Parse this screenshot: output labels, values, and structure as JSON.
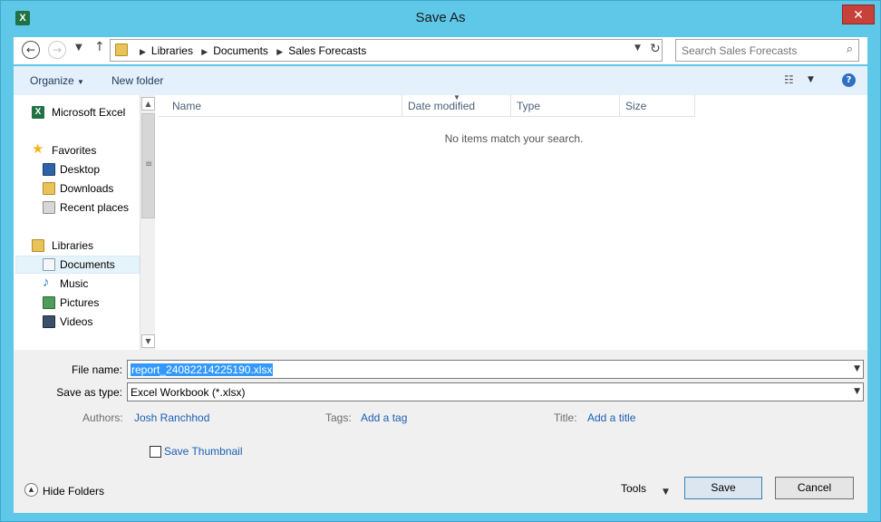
{
  "window": {
    "title": "Save As",
    "app_icon_letter": "X",
    "close_label": "✕"
  },
  "nav": {
    "breadcrumbs": [
      "Libraries",
      "Documents",
      "Sales Forecasts"
    ],
    "search_placeholder": "Search Sales Forecasts"
  },
  "toolbar": {
    "organize_label": "Organize",
    "new_folder_label": "New folder"
  },
  "sidebar": {
    "items": [
      {
        "label": "Microsoft Excel",
        "icon": "excel-icon",
        "color": "#207245"
      },
      {
        "label": "Favorites",
        "icon": "star-icon",
        "color": "#f2b51b"
      },
      {
        "label": "Desktop",
        "icon": "desktop-icon",
        "color": "#2d62a8"
      },
      {
        "label": "Downloads",
        "icon": "downloads-folder-icon",
        "color": "#e9c35a"
      },
      {
        "label": "Recent places",
        "icon": "recent-places-icon",
        "color": "#8e8e8e"
      },
      {
        "label": "Libraries",
        "icon": "libraries-icon",
        "color": "#e9c35a"
      },
      {
        "label": "Documents",
        "icon": "documents-icon",
        "color": "#cfd8e3",
        "selected": true
      },
      {
        "label": "Music",
        "icon": "music-icon",
        "color": "#2f78c4"
      },
      {
        "label": "Pictures",
        "icon": "pictures-icon",
        "color": "#4f9d5a"
      },
      {
        "label": "Videos",
        "icon": "videos-icon",
        "color": "#3b4f6a"
      }
    ]
  },
  "file_list": {
    "columns": [
      "Name",
      "Date modified",
      "Type",
      "Size"
    ],
    "empty_message": "No items match your search."
  },
  "form": {
    "file_name_label": "File name:",
    "file_name_value": "report_24082214225190.xlsx",
    "save_as_type_label": "Save as type:",
    "save_as_type_value": "Excel Workbook (*.xlsx)",
    "authors_label": "Authors:",
    "authors_value": "Josh Ranchhod",
    "tags_label": "Tags:",
    "tags_value": "Add a tag",
    "title_label": "Title:",
    "title_value": "Add a title",
    "save_thumbnail_label": "Save Thumbnail",
    "save_thumbnail_checked": false
  },
  "footer": {
    "hide_folders_label": "Hide Folders",
    "tools_label": "Tools",
    "save_label": "Save",
    "cancel_label": "Cancel"
  }
}
